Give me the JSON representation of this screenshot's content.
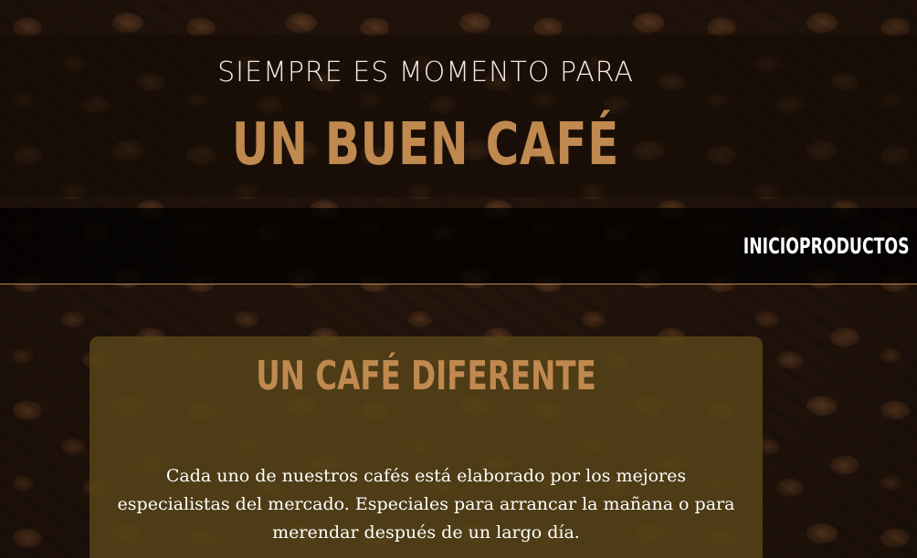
{
  "hero": {
    "tagline": "SIEMPRE ES MOMENTO PARA",
    "title": "UN BUEN CAFÉ"
  },
  "nav": {
    "items": [
      {
        "label": "INICIO"
      },
      {
        "label": "PRODUCTOS"
      }
    ]
  },
  "card": {
    "title": "UN CAFÉ DIFERENTE",
    "body": "Cada uno de nuestros cafés está elaborado por los mejores especialistas del mercado. Especiales para arrancar la mañana o para merendar después de un largo día."
  },
  "colors": {
    "accent": "#c0894f",
    "card_background": "#564318",
    "nav_background": "#000000"
  }
}
